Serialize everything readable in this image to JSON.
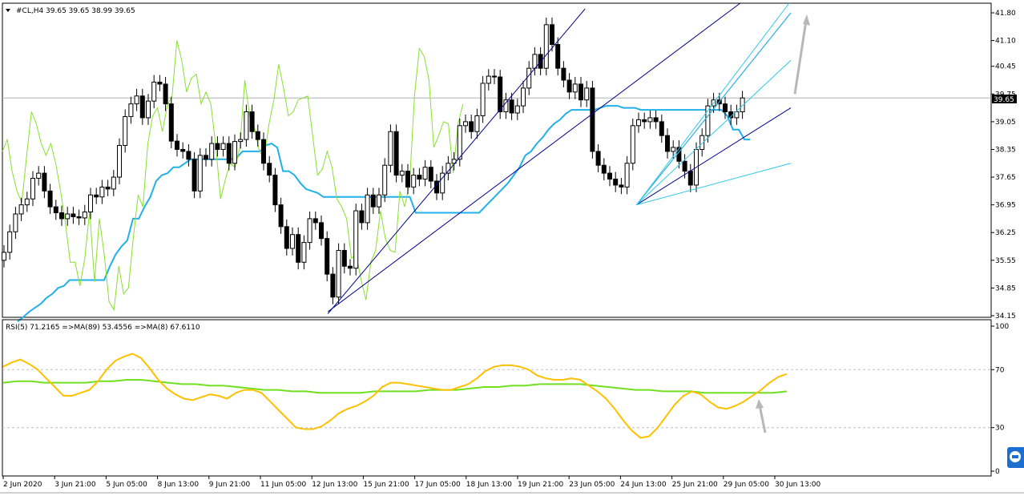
{
  "window": {
    "caption": "#CL,H4  39.65 39.65 38.99 39.65",
    "rsi_caption": "RSI(5) 71.2165  =>MA(89) 53.4556  =>MA(8) 67.6110",
    "current_price_label": "39.65"
  },
  "colors": {
    "bull_candle": "#ffffff",
    "bear_candle": "#000000",
    "kijun_line": "#22b0e8",
    "chikou_line": "#88e030",
    "channel_main": "#00008b",
    "channel_inner": "#30c8e8",
    "arrow": "#b8b8b8",
    "rsi_fast": "#ffc000",
    "rsi_slow": "#70e020",
    "level_line": "#c0c0c0"
  },
  "chart_data": [
    {
      "type": "candlestick",
      "symbol": "#CL",
      "timeframe": "H4",
      "ylim": [
        34.15,
        41.8
      ],
      "y_ticks": [
        "41.80",
        "41.10",
        "40.45",
        "39.75",
        "39.05",
        "38.35",
        "37.65",
        "36.95",
        "36.25",
        "35.55",
        "34.85",
        "34.15"
      ],
      "x_ticks": [
        "2 Jun 2020",
        "3 Jun 21:00",
        "5 Jun 05:00",
        "8 Jun 13:00",
        "9 Jun 21:00",
        "11 Jun 05:00",
        "12 Jun 13:00",
        "15 Jun 21:00",
        "17 Jun 05:00",
        "18 Jun 13:00",
        "19 Jun 21:00",
        "23 Jun 05:00",
        "24 Jun 13:00",
        "25 Jun 21:00",
        "29 Jun 05:00",
        "30 Jun 13:00"
      ],
      "current_price": 39.65,
      "close": [
        35.75,
        36.27,
        36.72,
        36.95,
        37.1,
        37.62,
        37.75,
        37.3,
        36.9,
        36.75,
        36.6,
        36.72,
        36.65,
        36.62,
        36.77,
        37.2,
        37.15,
        37.4,
        37.35,
        37.65,
        38.45,
        39.18,
        39.5,
        39.7,
        39.15,
        39.57,
        40.05,
        40.0,
        39.5,
        38.56,
        38.35,
        38.3,
        38.1,
        37.3,
        38.2,
        38.1,
        38.5,
        38.35,
        38.5,
        38.0,
        38.55,
        38.6,
        39.3,
        38.8,
        38.6,
        38.0,
        37.7,
        36.95,
        36.4,
        35.85,
        36.2,
        35.5,
        36.0,
        36.6,
        36.5,
        36.1,
        35.2,
        34.62,
        35.8,
        35.4,
        35.35,
        36.8,
        36.5,
        37.2,
        36.9,
        37.2,
        37.95,
        38.8,
        37.7,
        37.8,
        37.4,
        37.7,
        37.6,
        37.9,
        37.55,
        37.25,
        37.75,
        38.0,
        38.1,
        38.95,
        39.05,
        38.8,
        39.2,
        40.02,
        40.2,
        40.18,
        39.3,
        39.6,
        39.27,
        39.45,
        39.9,
        40.4,
        40.75,
        40.4,
        41.5,
        41.0,
        40.4,
        40.1,
        39.8,
        40.0,
        39.6,
        39.9,
        38.3,
        37.95,
        37.75,
        37.6,
        37.45,
        37.4,
        38.0,
        38.95,
        39.1,
        39.05,
        39.15,
        39.05,
        38.7,
        38.3,
        38.4,
        38.05,
        37.8,
        37.45,
        38.35,
        38.7,
        39.45,
        39.6,
        39.5,
        39.3,
        39.15,
        39.3,
        39.65
      ],
      "kijun": [
        34.0,
        34.12,
        34.25,
        34.35,
        34.45,
        34.6,
        34.7,
        34.85,
        34.9,
        35.05,
        35.05,
        35.05,
        35.05,
        35.05,
        35.05,
        35.05,
        35.4,
        35.7,
        35.9,
        36.05,
        36.6,
        36.6,
        36.9,
        37.15,
        37.55,
        37.7,
        37.75,
        37.9,
        37.9,
        38.0,
        38.1,
        38.1,
        38.1,
        38.1,
        38.1,
        38.1,
        38.1,
        38.1,
        38.15,
        38.3,
        38.3,
        38.3,
        38.3,
        38.45,
        38.5,
        38.4,
        37.8,
        37.8,
        37.7,
        37.5,
        37.35,
        37.3,
        37.25,
        37.15,
        37.15,
        37.15,
        37.15,
        37.15,
        37.15,
        37.15,
        37.15,
        37.15,
        37.15,
        37.15,
        37.15,
        37.15,
        37.15,
        37.15,
        37.15,
        36.75,
        36.75,
        36.75,
        36.75,
        36.75,
        36.75,
        36.75,
        36.75,
        36.75,
        36.75,
        36.75,
        36.75,
        36.9,
        37.05,
        37.2,
        37.35,
        37.5,
        37.7,
        37.9,
        38.2,
        38.3,
        38.5,
        38.65,
        38.85,
        39.0,
        39.1,
        39.25,
        39.35,
        39.35,
        39.35,
        39.35,
        39.35,
        39.4,
        39.45,
        39.45,
        39.45,
        39.4,
        39.4,
        39.4,
        39.35,
        39.35,
        39.35,
        39.35,
        39.35,
        39.35,
        39.35,
        39.35,
        39.35,
        39.35,
        39.35,
        39.35,
        39.35,
        39.35,
        39.35,
        39.2,
        38.85,
        38.85,
        38.6,
        38.6
      ],
      "chikou": [
        38.3,
        38.6,
        37.8,
        37.3,
        37.0,
        38.2,
        39.3,
        39.0,
        38.5,
        38.2,
        38.5,
        38.0,
        37.3,
        36.5,
        35.5,
        35.5,
        34.9,
        35.6,
        36.8,
        35.0,
        36.6,
        35.7,
        34.5,
        34.3,
        35.4,
        34.7,
        34.85,
        36.1,
        37.2,
        36.9,
        38.5,
        39.2,
        39.4,
        38.8,
        39.45,
        39.7,
        41.1,
        40.6,
        39.8,
        40.15,
        40.25,
        39.5,
        39.8,
        39.5,
        38.45,
        37.1,
        37.6,
        38.0,
        37.9,
        38.4,
        40.1,
        39.2,
        38.9,
        38.3,
        38.15,
        39.0,
        39.6,
        40.5,
        39.9,
        39.2,
        39.3,
        39.6,
        39.65,
        39.7,
        38.7,
        37.7,
        37.85,
        38.3,
        37.9,
        37.1,
        36.9,
        36.6,
        35.6,
        35.7,
        35.05,
        34.55,
        35.5,
        35.8,
        36.8,
        36.1,
        35.8,
        35.75,
        37.3,
        36.9,
        37.5,
        39.7,
        40.9,
        40.7,
        40.1,
        38.4,
        38.7,
        39.05,
        39.0,
        37.75,
        39.0,
        39.5
      ],
      "channel_main_lines": [
        {
          "from": [
            "12 Jun 13:00",
            34.2
          ],
          "to": [
            "23 Jun 05:00",
            41.9
          ]
        },
        {
          "from": [
            "12 Jun 13:00",
            34.25
          ],
          "to": [
            "30 Jun 13:00",
            43.0
          ]
        },
        {
          "from": [
            "24 Jun 13:00",
            36.95
          ],
          "to": [
            "30 Jun 13:00",
            39.4
          ]
        },
        {
          "from": [
            "24 Jun 13:00",
            36.95
          ],
          "to": [
            "30 Jun 13:00",
            41.8
          ]
        }
      ],
      "channel_inner_lines": [
        {
          "from": [
            "24 Jun 13:00",
            36.95
          ],
          "to": [
            "30 Jun 13:00",
            38.0
          ]
        },
        {
          "from": [
            "24 Jun 13:00",
            36.95
          ],
          "to": [
            "30 Jun 13:00",
            40.6
          ]
        },
        {
          "from": [
            "24 Jun 13:00",
            36.95
          ],
          "to": [
            "30 Jun 13:00",
            41.8
          ]
        },
        {
          "from": [
            "24 Jun 13:00",
            36.95
          ],
          "to": [
            "30 Jun 13:00",
            42.1
          ]
        }
      ],
      "arrow_up": {
        "from": [
          "30 Jun 13:00",
          39.75
        ],
        "to": [
          "30 Jun 13:00",
          41.6
        ]
      }
    },
    {
      "type": "line",
      "indicator": "RSI",
      "ylim": [
        0,
        100
      ],
      "y_ticks": [
        "100",
        "70",
        "30",
        "0"
      ],
      "levels": [
        70,
        30
      ],
      "series": [
        {
          "name": "RSI(5)",
          "values": [
            72,
            75,
            77,
            74,
            70,
            64,
            58,
            52,
            52,
            54,
            56,
            62,
            70,
            76,
            79,
            81,
            78,
            71,
            63,
            57,
            53,
            50,
            49,
            51,
            53,
            52,
            50,
            54,
            56,
            56,
            54,
            48,
            42,
            36,
            30,
            29,
            29,
            31,
            35,
            40,
            43,
            45,
            48,
            52,
            58,
            61,
            61,
            60,
            59,
            58,
            57,
            56,
            56,
            58,
            60,
            64,
            69,
            72,
            73,
            73,
            72,
            70,
            66,
            64,
            63,
            63,
            64,
            63,
            59,
            55,
            50,
            43,
            35,
            28,
            23,
            24,
            30,
            38,
            46,
            52,
            55,
            53,
            48,
            44,
            43,
            45,
            48,
            52,
            56,
            61,
            65,
            67
          ]
        },
        {
          "name": "MA(89)",
          "values": [
            61,
            62,
            62,
            61,
            61,
            61,
            61,
            62,
            62,
            63,
            63,
            62,
            61,
            60,
            60,
            59,
            59,
            58,
            57,
            56,
            56,
            55,
            55,
            54,
            54,
            54,
            54,
            55,
            55,
            55,
            55,
            56,
            56,
            56,
            57,
            58,
            58,
            59,
            59,
            60,
            60,
            60,
            60,
            59,
            58,
            57,
            56,
            56,
            55,
            55,
            55,
            54,
            54,
            54,
            54,
            54,
            54,
            55
          ]
        }
      ]
    }
  ]
}
